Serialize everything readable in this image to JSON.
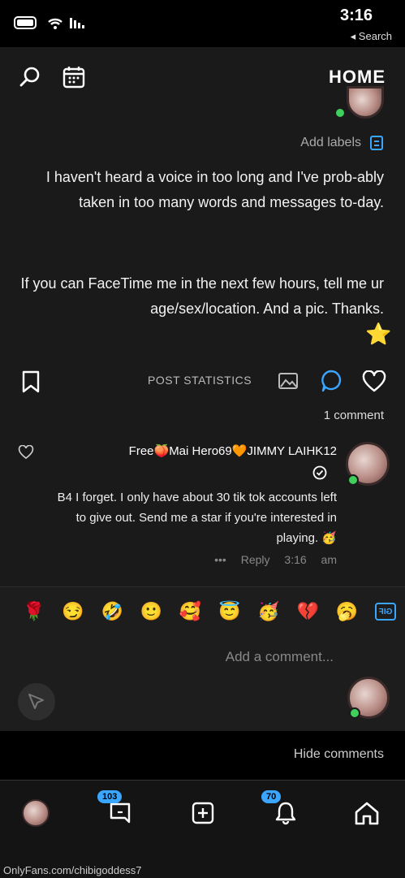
{
  "status_bar": {
    "time": "3:16",
    "back_label": "◂ Search"
  },
  "header": {
    "title": "HOME",
    "icons": [
      "calendar-icon",
      "search-icon"
    ]
  },
  "post": {
    "labels_button": "Add labels",
    "text_paragraph_1": "I haven't heard a voice in too long and I've prob-ably taken in too many words and messages to-day.",
    "text_paragraph_2": "If you can FaceTime me in the next few hours, tell me ur age/sex/location. And a pic. Thanks.",
    "emoji_star": "⭐",
    "stats_label": "POST STATISTICS",
    "comments_count": "1 comment"
  },
  "comment": {
    "author": "Free🍑Mai Hero69🧡JIMMY LAIHK12",
    "text": "B4 I forget. I only have about 30 tik tok accounts left to give out. Send me a star if you're interested in playing. 🥳",
    "time": "3:16 am",
    "reply": "Reply",
    "more": "•••"
  },
  "emoji_bar": [
    "🌹",
    "😏",
    "🤣",
    "🙂",
    "🥰",
    "😇",
    "🥳",
    "💔",
    "🥱"
  ],
  "gif_label": "GIF",
  "composer": {
    "placeholder": "Add a comment..."
  },
  "hide_comments": "Hide comments",
  "tabbar": {
    "messages_badge": "103",
    "notifications_badge": "70"
  },
  "footer_url": "OnlyFans.com/chibigoddess7",
  "colors": {
    "accent": "#3aa6ff",
    "online": "#3ecf5c",
    "background": "#1a1a1a"
  }
}
